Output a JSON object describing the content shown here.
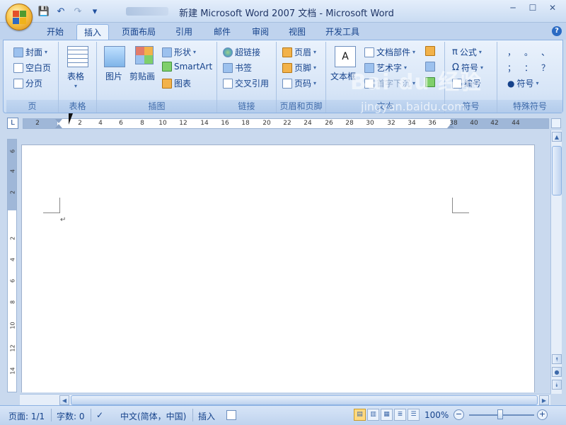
{
  "window": {
    "title": "新建 Microsoft Word 2007 文档 - Microsoft Word",
    "controls": [
      "─",
      "☐",
      "✕"
    ]
  },
  "qat": {
    "save": "💾",
    "undo": "↶",
    "redo": "↷",
    "more": "▾"
  },
  "tabs": [
    {
      "label": "开始"
    },
    {
      "label": "插入",
      "active": true
    },
    {
      "label": "页面布局"
    },
    {
      "label": "引用"
    },
    {
      "label": "邮件"
    },
    {
      "label": "审阅"
    },
    {
      "label": "视图"
    },
    {
      "label": "开发工具"
    }
  ],
  "help": "?",
  "ribbon": {
    "pages": {
      "label": "页",
      "items": [
        "封面",
        "空白页",
        "分页"
      ]
    },
    "table": {
      "label": "表格",
      "button": "表格"
    },
    "illustrations": {
      "label": "插图",
      "picture": "图片",
      "clipart": "剪贴画",
      "shapes": "形状",
      "smartart": "SmartArt",
      "chart": "图表"
    },
    "links": {
      "label": "链接",
      "items": [
        "超链接",
        "书签",
        "交叉引用"
      ]
    },
    "header_footer": {
      "label": "页眉和页脚",
      "items": [
        "页眉",
        "页脚",
        "页码"
      ]
    },
    "text": {
      "label": "文本",
      "textbox": "文本框",
      "quickparts": "文档部件",
      "wordart": "艺术字",
      "dropcap": "首字下沉"
    },
    "symbols": {
      "label": "符号",
      "equation": "公式",
      "symbol": "符号",
      "numbering": "编号"
    },
    "special": {
      "label": "特殊符号",
      "chars": [
        "，",
        "。",
        "、",
        "；",
        "：",
        "？"
      ],
      "symbol": "符号"
    }
  },
  "ruler": {
    "horizontal_ticks": [
      "2",
      "2",
      "4",
      "6",
      "8",
      "10",
      "12",
      "14",
      "16",
      "18",
      "20",
      "22",
      "24",
      "26",
      "28",
      "30",
      "32",
      "34",
      "36",
      "38",
      "40",
      "42",
      "44"
    ],
    "vertical_ticks": [
      "6",
      "4",
      "2",
      "",
      "2",
      "4",
      "6",
      "8",
      "10",
      "12",
      "14"
    ],
    "toggle": "L"
  },
  "document": {
    "paragraph_mark": "↵"
  },
  "status": {
    "page": "页面: 1/1",
    "words": "字数: 0",
    "language": "中文(简体，中国)",
    "mode": "插入",
    "zoom": "100%",
    "zoom_out": "−",
    "zoom_in": "+"
  },
  "watermark": {
    "brand": "Bai du 经验",
    "url": "jingyan.baidu.com"
  }
}
